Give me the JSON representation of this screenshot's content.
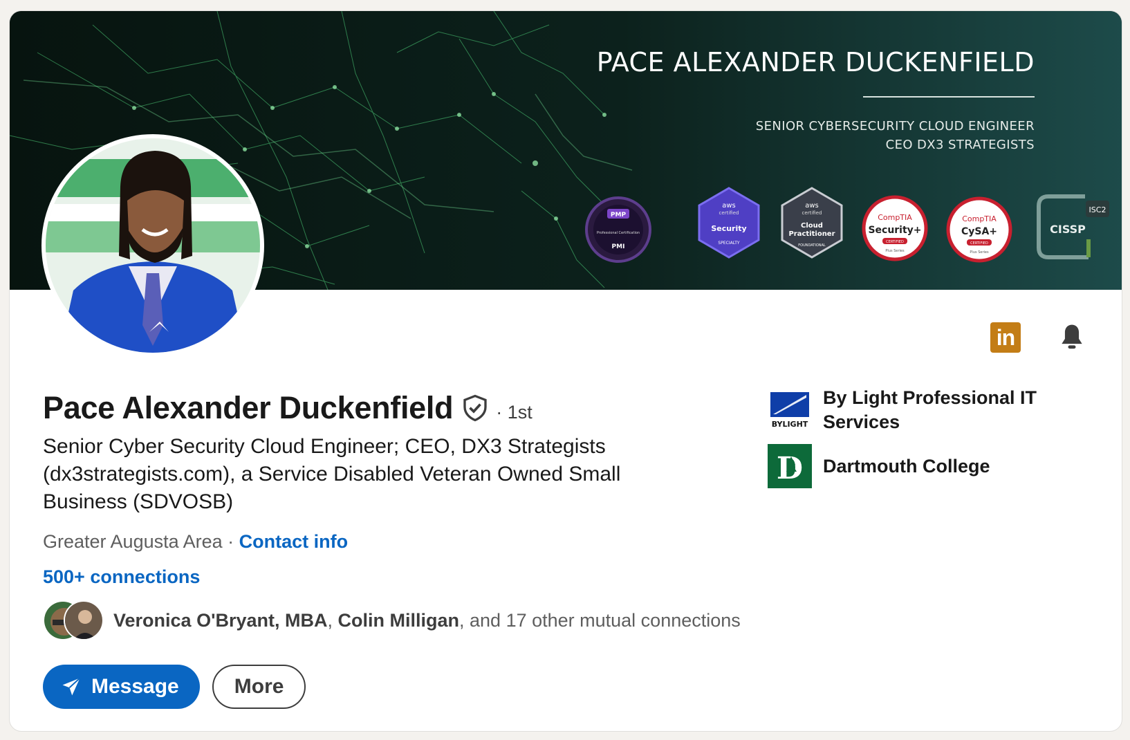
{
  "banner": {
    "name": "PACE ALEXANDER DUCKENFIELD",
    "subtitle_line1": "SENIOR CYBERSECURITY CLOUD ENGINEER",
    "subtitle_line2": "CEO DX3 STRATEGISTS",
    "badges": [
      {
        "name": "pmp-badge",
        "lines": [
          "PMP",
          "Professional Certification",
          "PMI"
        ]
      },
      {
        "name": "aws-security-badge",
        "lines": [
          "aws",
          "certified",
          "Security",
          "SPECIALTY"
        ]
      },
      {
        "name": "aws-cloud-practitioner-badge",
        "lines": [
          "aws",
          "certified",
          "Cloud",
          "Practitioner",
          "FOUNDATIONAL"
        ]
      },
      {
        "name": "comptia-security-badge",
        "lines": [
          "CompTIA",
          "Security+",
          "CERTIFIED",
          "Plus Series"
        ]
      },
      {
        "name": "comptia-cysa-badge",
        "lines": [
          "CompTIA",
          "CySA+",
          "CERTIFIED",
          "Plus Series"
        ]
      },
      {
        "name": "cissp-badge",
        "lines": [
          "ISC2",
          "CISSP"
        ]
      }
    ]
  },
  "profile": {
    "name": "Pace Alexander Duckenfield",
    "degree": "· 1st",
    "headline": "Senior Cyber Security Cloud Engineer; CEO, DX3 Strategists (dx3strategists.com), a Service Disabled Veteran Owned Small Business (SDVOSB)",
    "location": "Greater Augusta Area",
    "location_sep": " · ",
    "contact_info": "Contact info",
    "connections": "500+ connections"
  },
  "mutual": {
    "name1": "Veronica O'Bryant, MBA",
    "sep": ", ",
    "name2": "Colin Milligan",
    "rest": ", and 17 other mutual connections"
  },
  "actions": {
    "message": "Message",
    "more": "More"
  },
  "orgs": [
    {
      "name": "By Light Professional IT Services",
      "logo_text": "BYLIGHT"
    },
    {
      "name": "Dartmouth College",
      "logo_text": "D"
    }
  ],
  "icons": {
    "linkedin": "in",
    "bell": "bell-icon"
  },
  "colors": {
    "link_blue": "#0a66c2",
    "banner_bg": "#0a1a16",
    "dartmouth_green": "#0d6a3a",
    "linkedin_gold": "#c37d16"
  }
}
